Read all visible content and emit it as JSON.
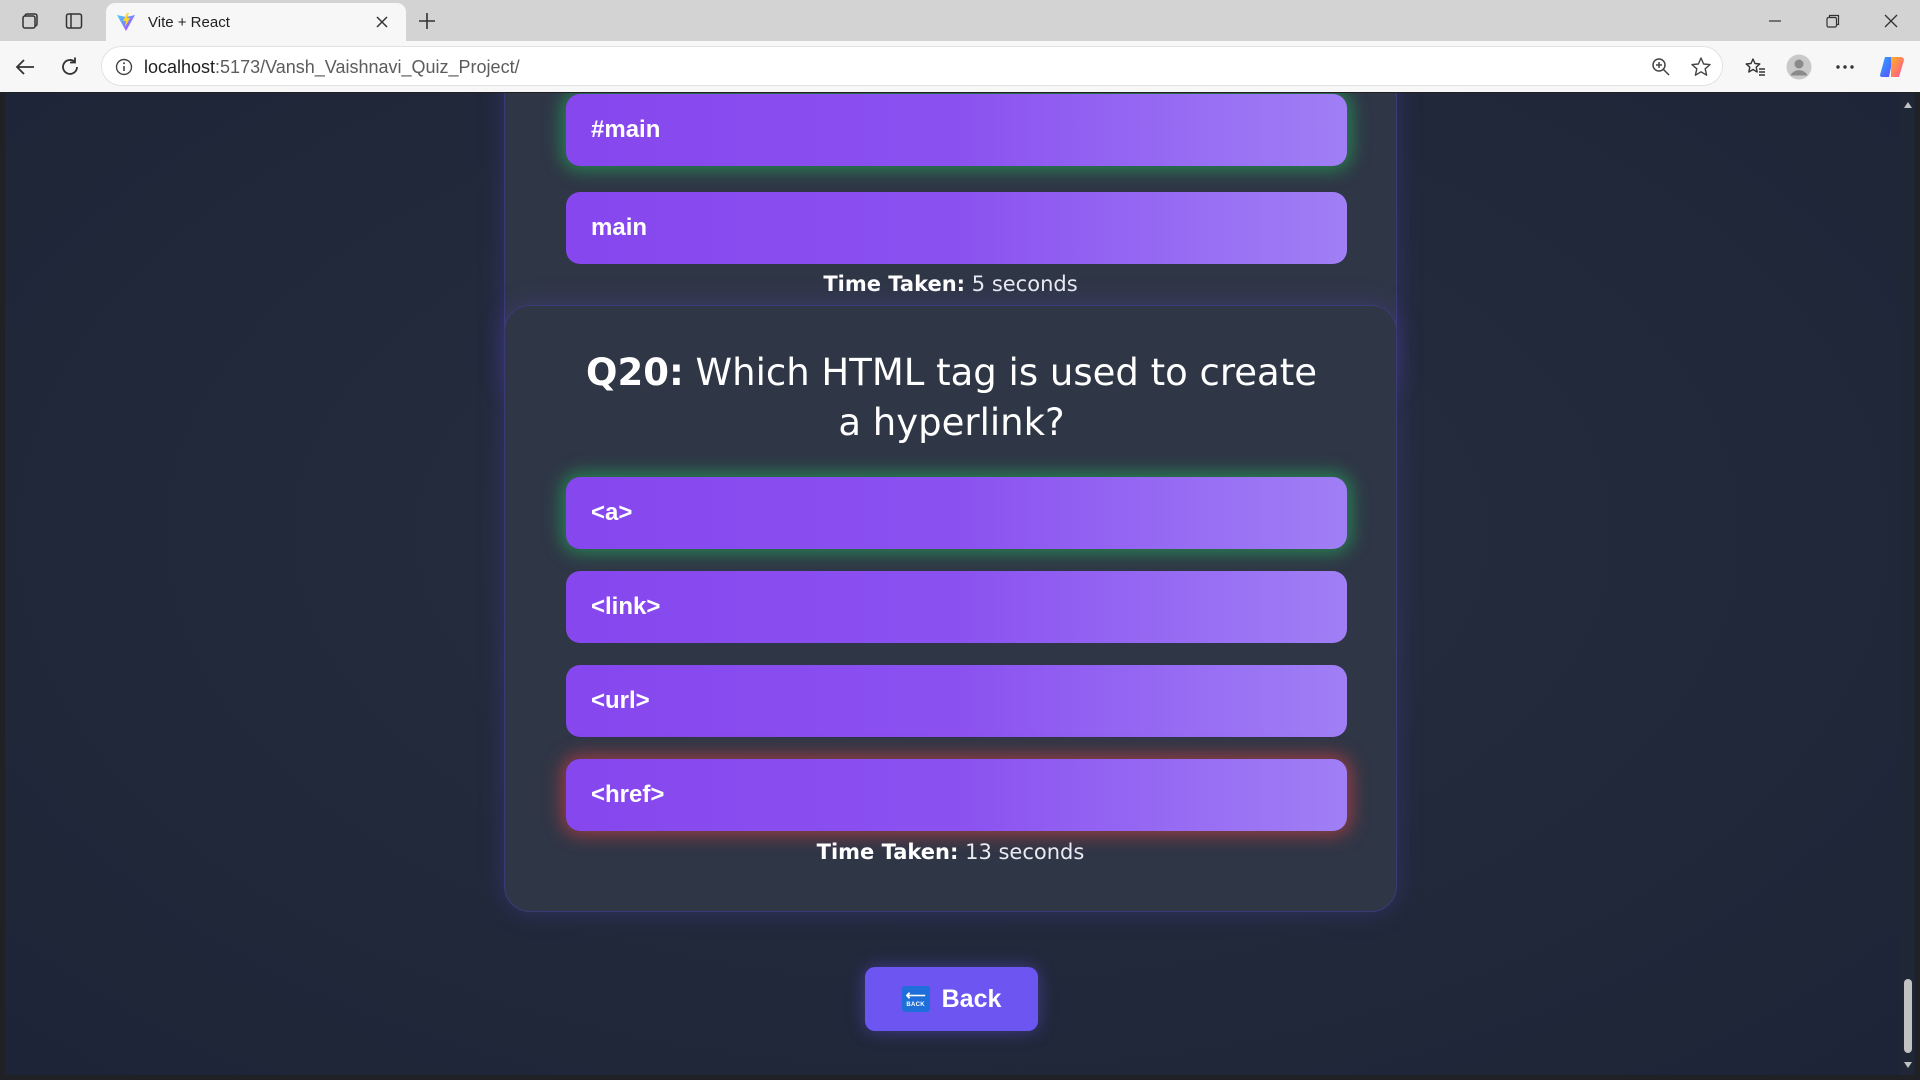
{
  "browser": {
    "tab_title": "Vite + React",
    "url_host": "localhost",
    "url_path": ":5173/Vansh_Vaishnavi_Quiz_Project/"
  },
  "previous_question": {
    "options": [
      "#main",
      "main"
    ],
    "time_label": "Time Taken:",
    "time_value": "5 seconds"
  },
  "question": {
    "number_label": "Q20:",
    "text": "Which HTML tag is used to create a hyperlink?",
    "options": [
      {
        "label": "<a>",
        "status": "correct"
      },
      {
        "label": "<link>",
        "status": "neutral"
      },
      {
        "label": "<url>",
        "status": "neutral"
      },
      {
        "label": "<href>",
        "status": "wrong"
      }
    ],
    "time_label": "Time Taken:",
    "time_value": "13 seconds"
  },
  "back_button": {
    "label": "Back",
    "icon": "back-emoji-icon",
    "icon_text": "BACK"
  },
  "colors": {
    "correct_glow": "#22c55e",
    "wrong_glow": "#ef4444",
    "option_gradient_start": "#8647ee",
    "option_gradient_end": "#a07ff5",
    "back_button": "#6d55f2"
  }
}
